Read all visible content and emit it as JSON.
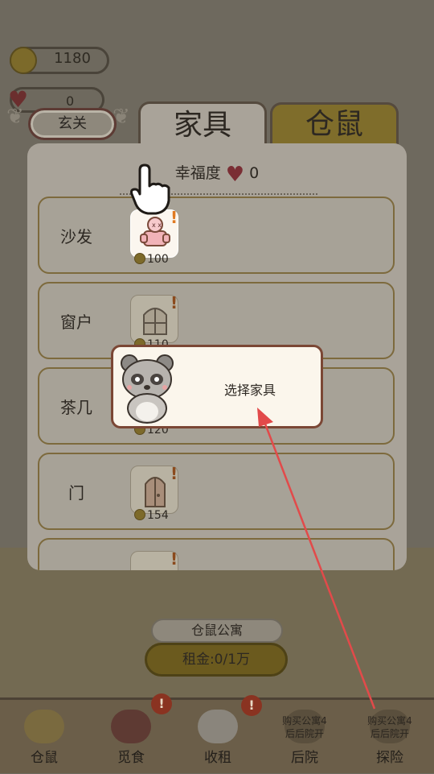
{
  "status": {
    "coins": "1180",
    "hearts": "0"
  },
  "top_button": {
    "label": "玄关"
  },
  "tabs": [
    {
      "label": "家具",
      "active": true
    },
    {
      "label": "仓鼠",
      "active": false
    }
  ],
  "panel": {
    "happiness_label": "幸福度",
    "happiness_value": "0",
    "items": [
      {
        "label": "沙发",
        "price": "100",
        "icon": "sofa-icon",
        "highlighted": true
      },
      {
        "label": "窗户",
        "price": "110",
        "icon": "window-icon",
        "highlighted": false
      },
      {
        "label": "茶几",
        "price": "120",
        "icon": "tea-table-icon",
        "highlighted": false
      },
      {
        "label": "门",
        "price": "154",
        "icon": "door-icon",
        "highlighted": false
      }
    ]
  },
  "tooltip": {
    "text": "选择家具"
  },
  "apartment": {
    "sign": "仓鼠公寓",
    "rent": "租金:0/1万"
  },
  "bottom_nav": [
    {
      "label": "仓鼠",
      "icon": "hamster-icon",
      "badge": false
    },
    {
      "label": "觅食",
      "icon": "food-bowl-icon",
      "badge": true
    },
    {
      "label": "收租",
      "icon": "maneki-cat-icon",
      "badge": true
    },
    {
      "label": "后院",
      "icon": "backyard-icon",
      "badge": false,
      "overlay": "购买公寓4\n后后院开"
    },
    {
      "label": "探险",
      "icon": "explore-icon",
      "badge": false,
      "overlay": "购买公寓4\n后后院开"
    }
  ],
  "colors": {
    "dim_background": "#6e695e",
    "panel": "#a9a399",
    "tooltip_bg": "#fbf6ec",
    "tooltip_border": "#7b4735",
    "arrow": "#e24a4a"
  }
}
